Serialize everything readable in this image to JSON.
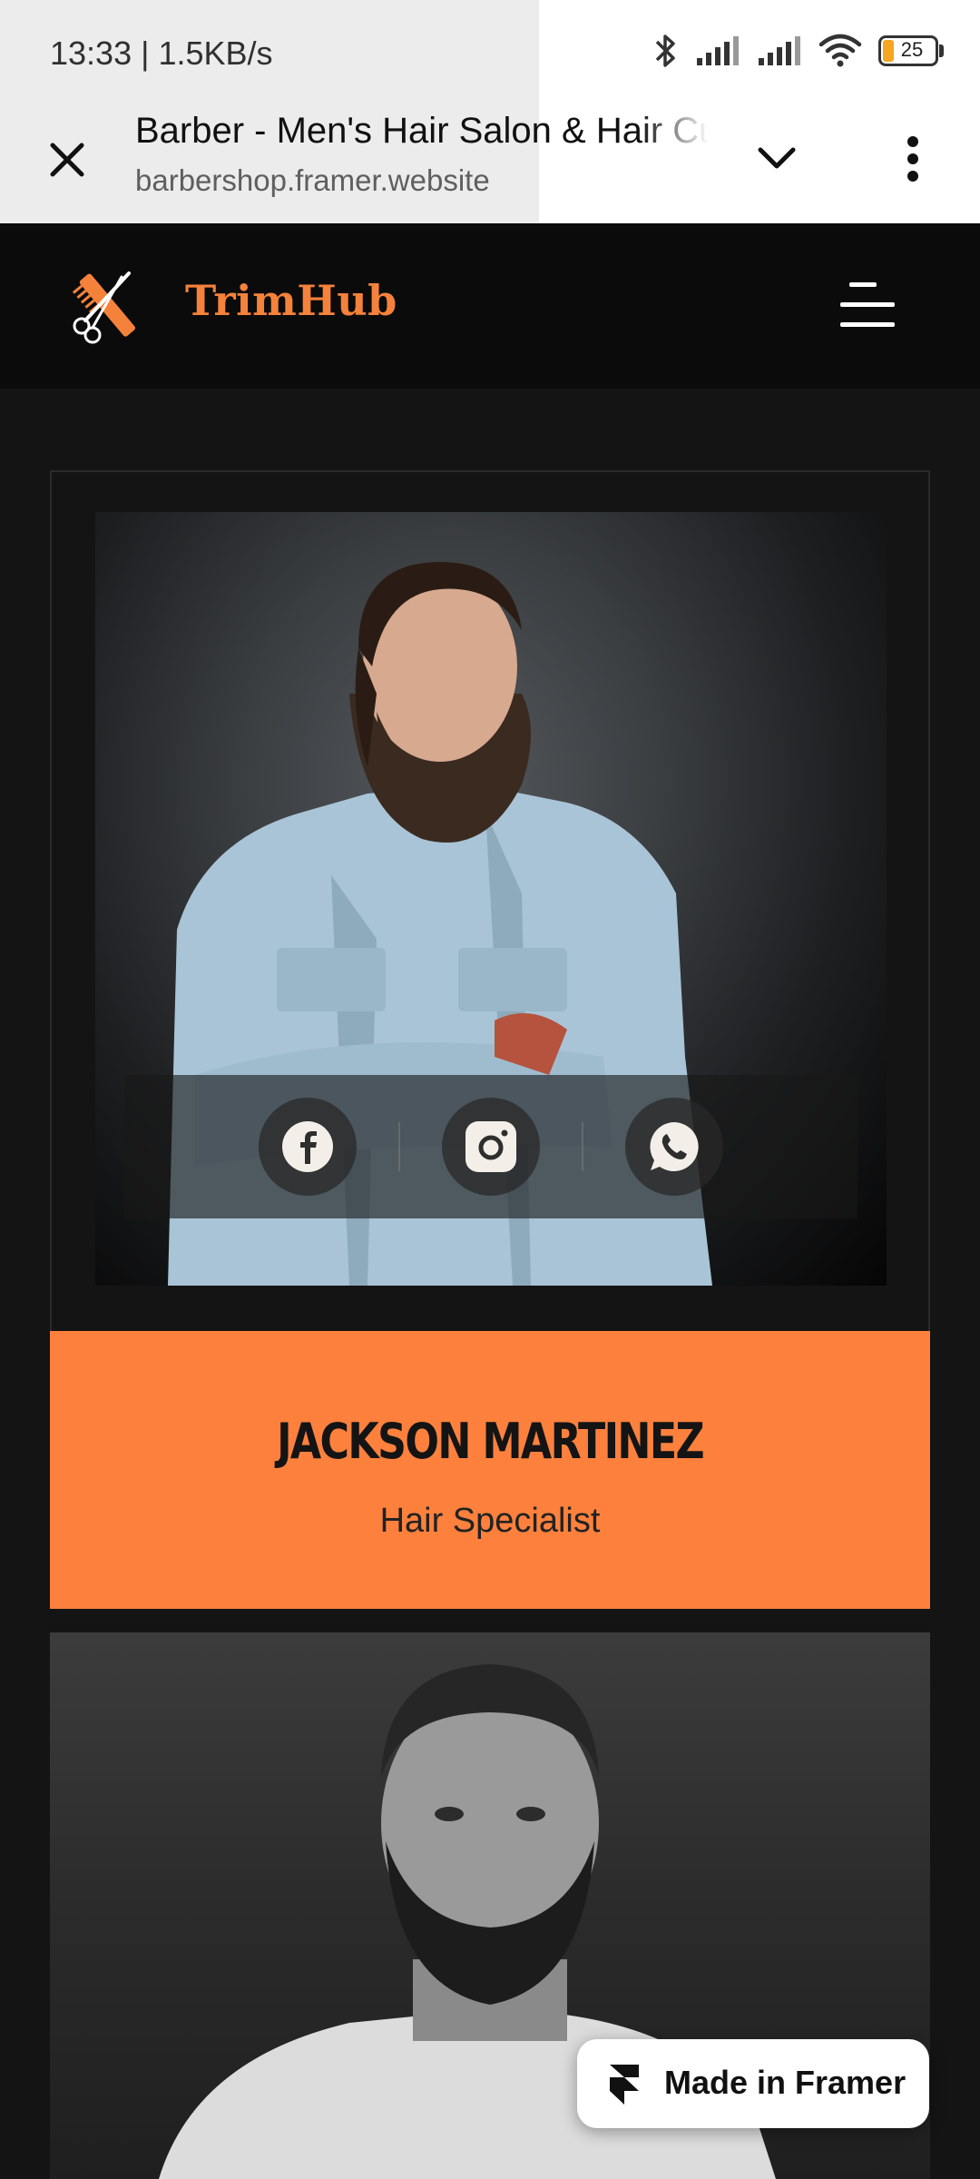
{
  "status_bar": {
    "time_speed": "13:33 | 1.5KB/s",
    "battery_level": "25",
    "icons": [
      "bluetooth-icon",
      "signal-icon",
      "signal-icon",
      "wifi-icon",
      "battery-icon"
    ]
  },
  "browser": {
    "page_title": "Barber - Men's Hair Salon & Hair Cutting",
    "url": "barbershop.framer.website",
    "icons": [
      "close-icon",
      "chevron-down-icon",
      "more-vertical-icon"
    ]
  },
  "site": {
    "brand": "TrimHub",
    "accent_color": "#f5823b",
    "menu_icon": "hamburger-menu-icon"
  },
  "team": [
    {
      "name": "JACKSON MARTINEZ",
      "role": "Hair Specialist",
      "socials": [
        "facebook-icon",
        "instagram-icon",
        "whatsapp-icon"
      ]
    },
    {
      "photo": "black-and-white portrait of bearded man"
    }
  ],
  "badge": {
    "label": "Made in Framer",
    "icon": "framer-logo-icon"
  }
}
